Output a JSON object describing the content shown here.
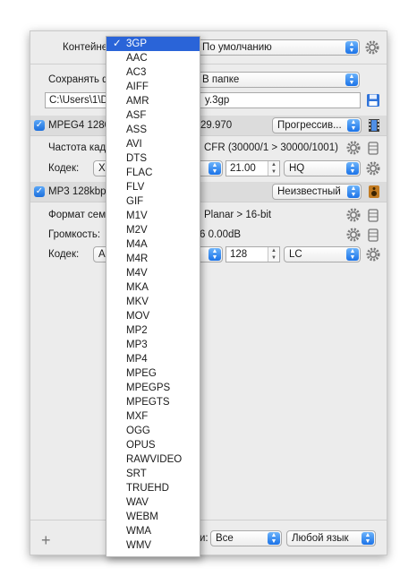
{
  "container": {
    "label": "Контейне",
    "value": "По умолчанию"
  },
  "save": {
    "label": "Сохранять ф",
    "mode_value": "В папке",
    "path_left": "C:\\Users\\1\\D",
    "path_right": "y.3gp"
  },
  "video": {
    "title": "MPEG4 1280",
    "fps_text": "29.970",
    "mode_value": "Прогрессив..."
  },
  "framerate": {
    "label": "Частота кад",
    "value_text": "CFR (30000/1 > 30000/1001)"
  },
  "video_codec": {
    "label": "Кодек:",
    "codec_value": "X",
    "quality_value": "21.00",
    "preset_value": "HQ"
  },
  "audio": {
    "title": "MP3 128kbp",
    "lang_value": "Неизвестный"
  },
  "sample_format": {
    "label": "Формат семп",
    "value_text": "Planar > 16-bit"
  },
  "volume": {
    "label": "Громкость:",
    "value_text": "6 0.00dB"
  },
  "audio_codec": {
    "label": "Кодек:",
    "codec_value": "A",
    "bitrate_value": "128",
    "profile_value": "LC"
  },
  "footer": {
    "add": "+",
    "filter_label_tail": "и:",
    "filter_value": "Все",
    "language_value": "Любой язык"
  },
  "format_menu": {
    "selected": "3GP",
    "items": [
      "3GP",
      "AAC",
      "AC3",
      "AIFF",
      "AMR",
      "ASF",
      "ASS",
      "AVI",
      "DTS",
      "FLAC",
      "FLV",
      "GIF",
      "M1V",
      "M2V",
      "M4A",
      "M4R",
      "M4V",
      "MKA",
      "MKV",
      "MOV",
      "MP2",
      "MP3",
      "MP4",
      "MPEG",
      "MPEGPS",
      "MPEGTS",
      "MXF",
      "OGG",
      "OPUS",
      "RAWVIDEO",
      "SRT",
      "TRUEHD",
      "WAV",
      "WEBM",
      "WMA",
      "WMV"
    ]
  },
  "colors": {
    "selection": "#2a64d8",
    "accent": "#1b73e8",
    "window_bg": "#ececec"
  }
}
